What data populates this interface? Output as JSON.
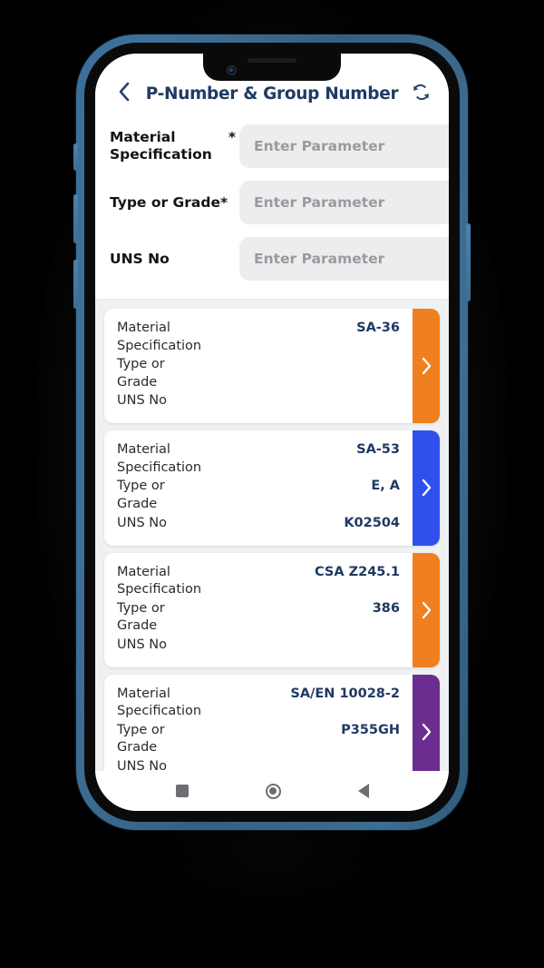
{
  "device": {
    "type": "smartphone-mockup",
    "bezel_color": "#3f7099",
    "nav_bar": {
      "recent_label": "recent-apps",
      "home_label": "home",
      "back_label": "back"
    }
  },
  "header": {
    "back_icon": "chevron-left-icon",
    "title": "P-Number & Group Number",
    "refresh_icon": "refresh-sync-icon",
    "title_color": "#1f3a63"
  },
  "form": {
    "fields": [
      {
        "label": "Material Specification",
        "label_line1": "Material",
        "label_line2": "Specification",
        "required_mark": "*",
        "required": true,
        "value": "",
        "placeholder": "Enter Parameter"
      },
      {
        "label": "Type or Grade*",
        "required_mark": "*",
        "required": true,
        "value": "",
        "placeholder": "Enter Parameter"
      },
      {
        "label": "UNS No",
        "required_mark": "",
        "required": false,
        "value": "",
        "placeholder": "Enter Parameter"
      }
    ]
  },
  "results": {
    "row_keys": {
      "material_specification": "Material Specification",
      "material_specification_line1": "Material",
      "material_specification_line2": "Specification",
      "type_or_grade": "Type or Grade",
      "type_or_grade_line1": "Type or",
      "type_or_grade_line2": "Grade",
      "uns_no": "UNS No"
    },
    "arrow_icon": "chevron-right-icon",
    "cards": [
      {
        "material_specification": "SA-36",
        "type_or_grade": "",
        "uns_no": "",
        "accent_color": "#ef7f1f"
      },
      {
        "material_specification": "SA-53",
        "type_or_grade": "E, A",
        "uns_no": "K02504",
        "accent_color": "#3050ee"
      },
      {
        "material_specification": "CSA Z245.1",
        "type_or_grade": "386",
        "uns_no": "",
        "accent_color": "#ef7f1f"
      },
      {
        "material_specification": "SA/EN 10028-2",
        "type_or_grade": "P355GH",
        "uns_no": "",
        "accent_color": "#6b2d8f"
      }
    ]
  }
}
